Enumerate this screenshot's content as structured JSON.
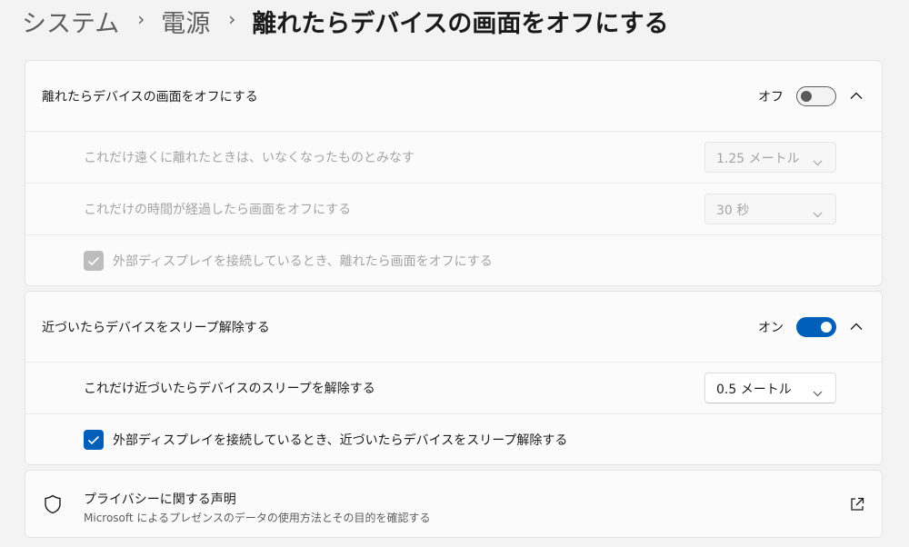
{
  "breadcrumb": {
    "items": [
      "システム",
      "電源"
    ],
    "current": "離れたらデバイスの画面をオフにする",
    "separator": "›"
  },
  "dim_section": {
    "title": "離れたらデバイスの画面をオフにする",
    "toggle_label": "オフ",
    "toggle_state": "off",
    "distance": {
      "label": "これだけ遠くに離れたときは、いなくなったものとみなす",
      "value": "1.25 メートル",
      "enabled": false
    },
    "timeout": {
      "label": "これだけの時間が経過したら画面をオフにする",
      "value": "30 秒",
      "enabled": false
    },
    "external_display": {
      "label": "外部ディスプレイを接続しているとき、離れたら画面をオフにする",
      "checked": true,
      "enabled": false
    }
  },
  "wake_section": {
    "title": "近づいたらデバイスをスリープ解除する",
    "toggle_label": "オン",
    "toggle_state": "on",
    "distance": {
      "label": "これだけ近づいたらデバイスのスリープを解除する",
      "value": "0.5 メートル",
      "enabled": true
    },
    "external_display": {
      "label": "外部ディスプレイを接続しているとき、近づいたらデバイスをスリープ解除する",
      "checked": true,
      "enabled": true
    }
  },
  "privacy": {
    "title": "プライバシーに関する声明",
    "description": "Microsoft によるプレゼンスのデータの使用方法とその目的を確認する",
    "icon": "shield-icon",
    "link_icon": "open-external-icon"
  },
  "colors": {
    "accent": "#005fb8",
    "background": "#f3f3f3",
    "card": "#fbfbfb",
    "disabled_text": "#a3a3a3"
  }
}
